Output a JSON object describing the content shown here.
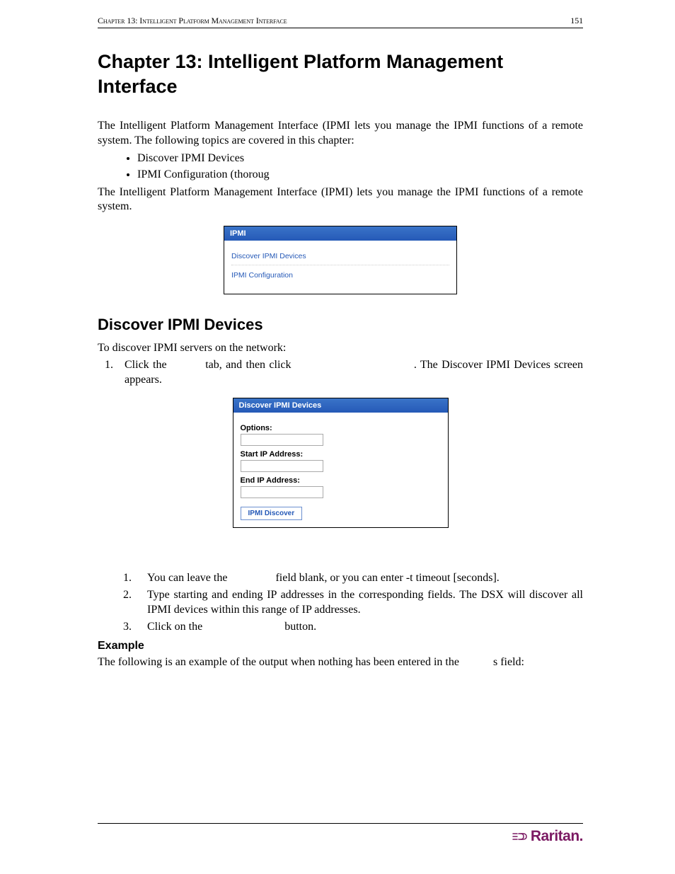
{
  "header": {
    "left": "Chapter 13: Intelligent Platform Management Interface",
    "pageNumber": "151"
  },
  "chapterTitle": "Chapter 13: Intelligent Platform Management Interface",
  "intro1": "The Intelligent Platform Management Interface (IPMI lets you manage the IPMI functions of a remote system. The following topics are covered in this chapter:",
  "bullets": [
    "Discover IPMI Devices",
    "IPMI Configuration (thoroug"
  ],
  "intro2": "The Intelligent Platform Management Interface (IPMI) lets you manage the IPMI functions of a remote system.",
  "ipmiPanel": {
    "title": "IPMI",
    "link1": "Discover IPMI Devices",
    "link2": "IPMI Configuration"
  },
  "sectionTitle": "Discover IPMI Devices",
  "sectionIntro": "To discover IPMI servers on the network:",
  "step1_a": "Click  the  ",
  "step1_b": "  tab,  and  then  click  ",
  "step1_c": ".  The  Discover  IPMI  Devices screen appears.",
  "discoverPanel": {
    "title": "Discover IPMI Devices",
    "labelOptions": "Options:",
    "labelStart": "Start IP Address:",
    "labelEnd": "End IP Address:",
    "button": "IPMI Discover"
  },
  "steps2": {
    "s1_a": "You can leave the ",
    "s1_b": " field blank, or you can enter -t timeout [seconds].",
    "s2": "Type starting and ending IP addresses in the corresponding fields. The DSX will discover all IPMI devices within this range of IP addresses.",
    "s3_a": "Click on the ",
    "s3_b": " button."
  },
  "subsection": "Example",
  "exampleText_a": "The following is an example of the output when nothing has been entered in the ",
  "exampleText_b": "s field:",
  "logoText": "Raritan."
}
